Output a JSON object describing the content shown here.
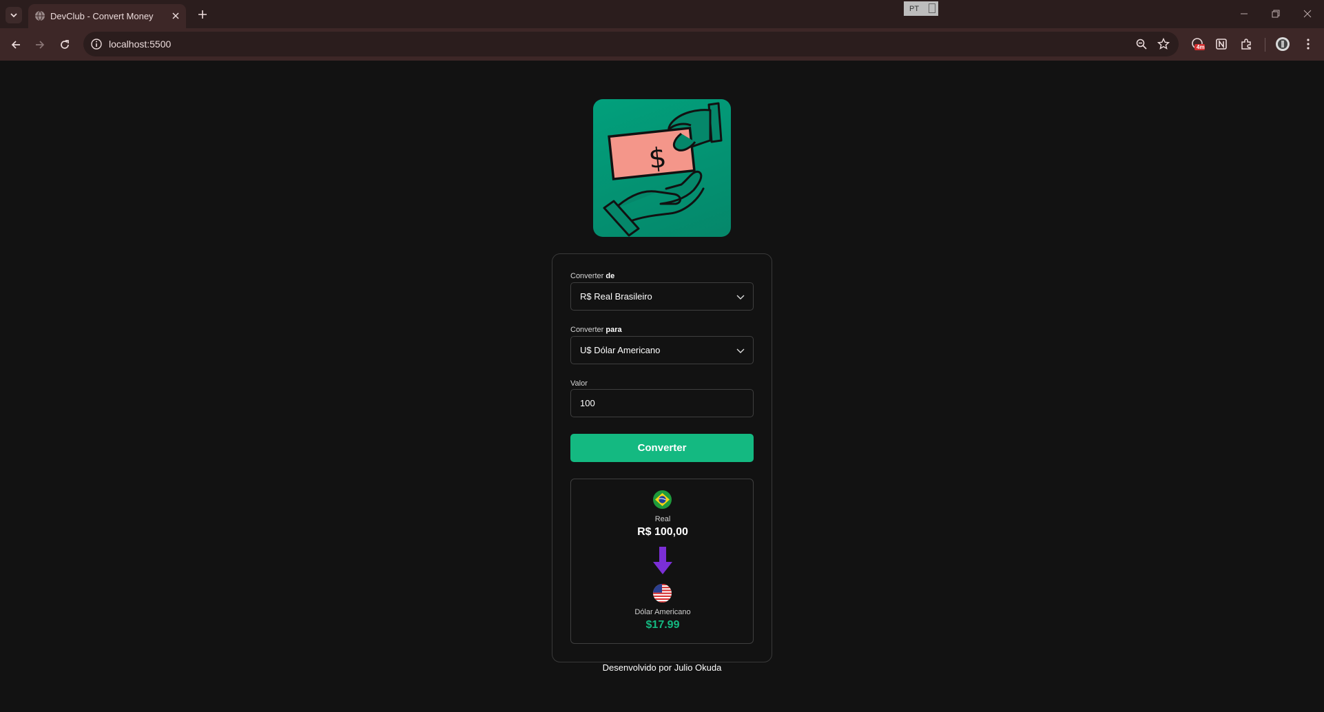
{
  "browser": {
    "tab_title": "DevClub - Convert Money",
    "url": "localhost:5500",
    "lang_badge": "PT",
    "extension_badge": "4m"
  },
  "form": {
    "from_label_prefix": "Converter",
    "from_label_bold": "de",
    "from_selected": "R$ Real Brasileiro",
    "to_label_prefix": "Converter",
    "to_label_bold": "para",
    "to_selected": "U$ Dólar Americano",
    "amount_label": "Valor",
    "amount_value": "100",
    "button_label": "Converter"
  },
  "result": {
    "from_currency_name": "Real",
    "from_currency_value": "R$ 100,00",
    "to_currency_name": "Dólar Americano",
    "to_currency_value": "$17.99",
    "to_value_color": "#14b981",
    "arrow_color": "#7b2fd6"
  },
  "footer": {
    "credit": "Desenvolvido por Julio Okuda"
  }
}
